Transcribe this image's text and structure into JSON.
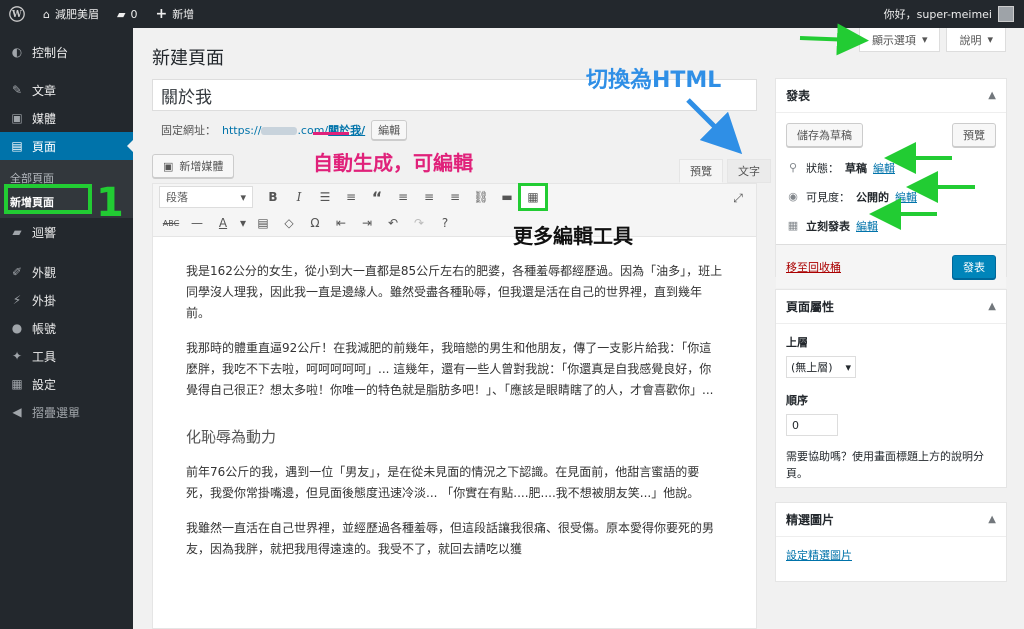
{
  "adminbar": {
    "site_name": "減肥美眉",
    "comments_count": "0",
    "new_label": "新增",
    "greeting": "你好，super-meimei"
  },
  "sidebar": {
    "items": [
      {
        "label": "控制台",
        "icon": "dashboard-icon"
      },
      {
        "label": "文章",
        "icon": "pin-icon"
      },
      {
        "label": "媒體",
        "icon": "media-icon"
      },
      {
        "label": "頁面",
        "icon": "pages-icon"
      },
      {
        "label": "迴響",
        "icon": "comment-icon"
      },
      {
        "label": "外觀",
        "icon": "paintbrush-icon"
      },
      {
        "label": "外掛",
        "icon": "plugin-icon"
      },
      {
        "label": "帳號",
        "icon": "user-icon"
      },
      {
        "label": "工具",
        "icon": "wrench-icon"
      },
      {
        "label": "設定",
        "icon": "settings-icon"
      },
      {
        "label": "摺疊選單",
        "icon": "collapse-icon"
      }
    ],
    "submenu": [
      "全部頁面",
      "新增頁面"
    ]
  },
  "screen_options": {
    "screen_label": "顯示選項",
    "help_label": "說明"
  },
  "page": {
    "heading": "新建頁面",
    "title_value": "關於我",
    "permalink_label": "固定網址：",
    "permalink_prefix": "https://",
    "permalink_domain": ".com/",
    "permalink_slug": "關於我/",
    "edit_label": "編輯"
  },
  "editor": {
    "add_media": "新增媒體",
    "tab_visual": "預覽",
    "tab_text": "文字",
    "format_select": "段落",
    "paragraphs": [
      "我是162公分的女生，從小到大一直都是85公斤左右的肥婆，各種羞辱都經歷過。因為「油多」，班上同學沒人理我，因此我一直是邊緣人。雖然受盡各種恥辱，但我還是活在自己的世界裡，直到幾年前。",
      "我那時的體重直逼92公斤！在我減肥的前幾年，我暗戀的男生和他朋友，傳了一支影片給我：「你這麼胖，我吃不下去啦，呵呵呵呵呵」... 這幾年，還有一些人曾對我說：「你還真是自我感覺良好，你覺得自己很正？想太多啦！你唯一的特色就是脂肪多吧！」、「應該是眼睛瞎了的人，才會喜歡你」...",
      "前年76公斤的我，遇到一位「男友」，是在從未見面的情況之下認識。在見面前，他甜言蜜語的要死，我愛你常掛嘴邊，但見面後態度迅速冷淡... 「你實在有點....肥....我不想被朋友笑...」他說。",
      "我雖然一直活在自己世界裡，並經歷過各種羞辱，但這段話讓我很痛、很受傷。原本愛得你要死的男友，因為我胖，就把我甩得遠遠的。我受不了，就回去請吃以獲"
    ],
    "subheading": "化恥辱為動力"
  },
  "publish_box": {
    "title": "發表",
    "save_draft": "儲存為草稿",
    "preview": "預覽",
    "status_label": "狀態：",
    "status_value": "草稿",
    "visibility_label": "可見度：",
    "visibility_value": "公開的",
    "schedule_label": "立刻發表",
    "edit_link": "編輯",
    "trash": "移至回收桶",
    "publish": "發表"
  },
  "attributes_box": {
    "title": "頁面屬性",
    "parent_label": "上層",
    "parent_value": "(無上層)",
    "order_label": "順序",
    "order_value": "0",
    "help_text": "需要協助嗎？使用畫面標題上方的說明分頁。"
  },
  "featured_box": {
    "title": "精選圖片",
    "link": "設定精選圖片"
  },
  "annotations": {
    "auto_generate": "自動生成，可編輯",
    "switch_html": "切換為HTML",
    "more_tools": "更多編輯工具",
    "step_number": "1"
  },
  "colors": {
    "accent": "#0073aa",
    "annotation_green": "#22cc33",
    "annotation_red": "#e0217a",
    "annotation_blue": "#2f8fe6"
  }
}
